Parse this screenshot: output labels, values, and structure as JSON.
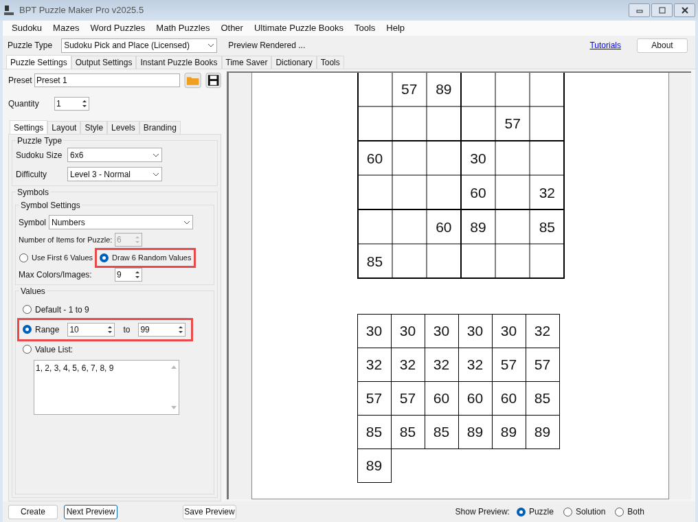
{
  "window": {
    "title": "BPT Puzzle Maker Pro v2025.5"
  },
  "menu": [
    "Sudoku",
    "Mazes",
    "Word Puzzles",
    "Math Puzzles",
    "Other",
    "Ultimate Puzzle Books",
    "Tools",
    "Help"
  ],
  "toolbar": {
    "puzzle_type_label": "Puzzle Type",
    "puzzle_type": "Sudoku Pick and Place (Licensed)",
    "status": "Preview Rendered ...",
    "tutorials_link": "Tutorials",
    "about_button": "About"
  },
  "main_tabs": [
    {
      "label": "Puzzle Settings",
      "selected": true
    },
    {
      "label": "Output Settings",
      "selected": false
    },
    {
      "label": "Instant Puzzle Books",
      "selected": false
    },
    {
      "label": "Time Saver",
      "selected": false
    },
    {
      "label": "Dictionary",
      "selected": false
    },
    {
      "label": "Tools",
      "selected": false
    }
  ],
  "preset": {
    "label": "Preset",
    "value": "Preset 1"
  },
  "quantity": {
    "label": "Quantity",
    "value": "1"
  },
  "settings_tabs": [
    {
      "label": "Settings",
      "selected": true
    },
    {
      "label": "Layout",
      "selected": false
    },
    {
      "label": "Style",
      "selected": false
    },
    {
      "label": "Levels",
      "selected": false
    },
    {
      "label": "Branding",
      "selected": false
    }
  ],
  "puzzle_type_group": {
    "title": "Puzzle Type",
    "sudoku_size_label": "Sudoku Size",
    "sudoku_size": "6x6",
    "difficulty_label": "Difficulty",
    "difficulty": "Level 3 - Normal"
  },
  "symbols_group": {
    "title": "Symbols",
    "settings_title": "Symbol Settings",
    "symbol_label": "Symbol",
    "symbol": "Numbers",
    "items_label": "Number of Items for Puzzle:",
    "items_value": "6",
    "items_disabled": true,
    "draw_options": [
      {
        "label": "Use First 6 Values",
        "selected": false,
        "highlighted": false
      },
      {
        "label": "Draw 6 Random Values",
        "selected": true,
        "highlighted": true
      }
    ],
    "max_colors_label": "Max Colors/Images:",
    "max_colors": "9"
  },
  "values_group": {
    "title": "Values",
    "default_option": {
      "label": "Default - 1 to 9",
      "selected": false
    },
    "range_option": {
      "label": "Range",
      "selected": true,
      "highlighted": true,
      "from": "10",
      "to_label": "to",
      "to": "99"
    },
    "list_option": {
      "label": "Value List:",
      "selected": false
    },
    "value_list": "1, 2, 3, 4, 5, 6, 7, 8, 9"
  },
  "puzzle_grid": [
    {
      "2": "57",
      "3": "89"
    },
    {
      "5": "57"
    },
    {
      "1": "60",
      "4": "30"
    },
    {
      "4": "60",
      "6": "32"
    },
    {
      "3": "60",
      "4": "89",
      "6": "85"
    },
    {
      "1": "85"
    }
  ],
  "symbol_list": [
    [
      "30",
      "30",
      "30",
      "30",
      "30",
      "32"
    ],
    [
      "32",
      "32",
      "32",
      "32",
      "57",
      "57"
    ],
    [
      "57",
      "57",
      "60",
      "60",
      "60",
      "85"
    ],
    [
      "85",
      "85",
      "85",
      "89",
      "89",
      "89"
    ],
    [
      "89"
    ]
  ],
  "bottom": {
    "create_button": "Create",
    "next_preview_button": "Next Preview",
    "save_preview_button": "Save Preview",
    "show_preview_label": "Show Preview:",
    "show_options": [
      {
        "label": "Puzzle",
        "selected": true
      },
      {
        "label": "Solution",
        "selected": false
      },
      {
        "label": "Both",
        "selected": false
      }
    ]
  }
}
